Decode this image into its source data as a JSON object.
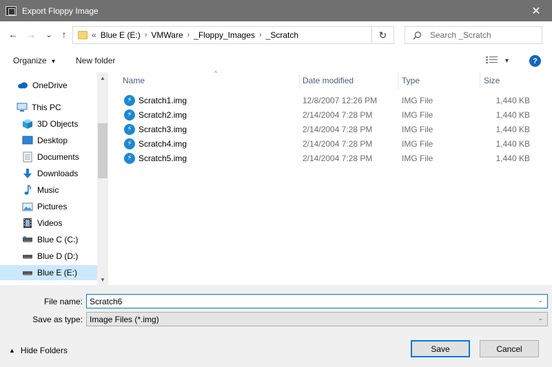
{
  "window": {
    "title": "Export Floppy Image",
    "close_glyph": "✕"
  },
  "nav": {
    "back_glyph": "←",
    "forward_glyph": "→",
    "recent_glyph": "⌄",
    "up_glyph": "↑",
    "overflow": "«",
    "breadcrumbs": [
      "Blue E (E:)",
      "VMWare",
      "_Floppy_Images",
      "_Scratch"
    ],
    "separator": "›",
    "refresh_glyph": "↻",
    "search_placeholder": "Search _Scratch"
  },
  "toolbar": {
    "organize_label": "Organize",
    "organize_arrow": "▾",
    "new_folder_label": "New folder",
    "view_arrow": "▾",
    "help_label": "?"
  },
  "sidebar": {
    "items": [
      {
        "label": "OneDrive",
        "icon": "cloud-icon"
      },
      {
        "label": "This PC",
        "icon": "computer-icon"
      },
      {
        "label": "3D Objects",
        "icon": "cube-icon"
      },
      {
        "label": "Desktop",
        "icon": "desktop-icon"
      },
      {
        "label": "Documents",
        "icon": "documents-icon"
      },
      {
        "label": "Downloads",
        "icon": "download-arrow-icon"
      },
      {
        "label": "Music",
        "icon": "music-note-icon"
      },
      {
        "label": "Pictures",
        "icon": "pictures-icon"
      },
      {
        "label": "Videos",
        "icon": "film-icon"
      },
      {
        "label": "Blue C (C:)",
        "icon": "drive-icon"
      },
      {
        "label": "Blue D (D:)",
        "icon": "drive-icon"
      },
      {
        "label": "Blue E (E:)",
        "icon": "drive-icon",
        "selected": true
      }
    ],
    "scroll_up": "▲",
    "scroll_down": "▼"
  },
  "files": {
    "columns": {
      "name": "Name",
      "date": "Date modified",
      "type": "Type",
      "size": "Size"
    },
    "sort_indicator": "^",
    "rows": [
      {
        "name": "Scratch1.img",
        "date": "12/8/2007 12:26 PM",
        "type": "IMG File",
        "size": "1,440 KB"
      },
      {
        "name": "Scratch2.img",
        "date": "2/14/2004 7:28 PM",
        "type": "IMG File",
        "size": "1,440 KB"
      },
      {
        "name": "Scratch3.img",
        "date": "2/14/2004 7:28 PM",
        "type": "IMG File",
        "size": "1,440 KB"
      },
      {
        "name": "Scratch4.img",
        "date": "2/14/2004 7:28 PM",
        "type": "IMG File",
        "size": "1,440 KB"
      },
      {
        "name": "Scratch5.img",
        "date": "2/14/2004 7:28 PM",
        "type": "IMG File",
        "size": "1,440 KB"
      }
    ]
  },
  "form": {
    "filename_label": "File name:",
    "filename_value": "Scratch6",
    "savetype_label": "Save as type:",
    "savetype_value": "Image Files (*.img)",
    "dropdown_glyph": "⌄"
  },
  "footer": {
    "hide_folders_glyph": "▲",
    "hide_folders_label": "Hide Folders",
    "save_label": "Save",
    "cancel_label": "Cancel"
  },
  "colors": {
    "accent": "#0078d7",
    "titlebar": "#707070",
    "selection": "#cce8ff"
  }
}
